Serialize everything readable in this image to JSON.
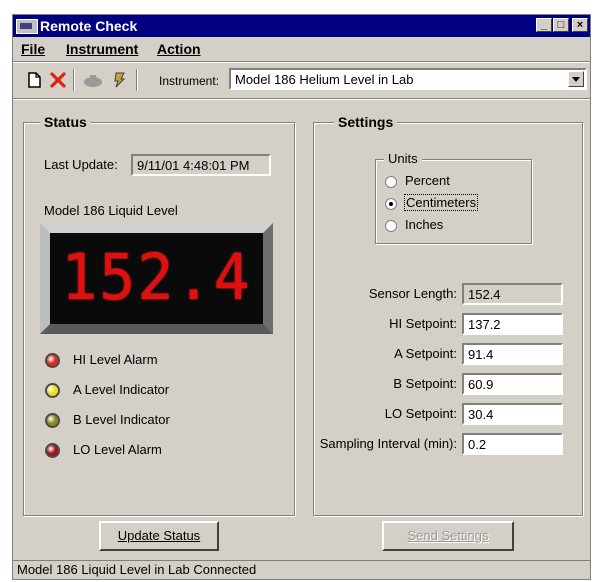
{
  "window": {
    "title": "Remote Check",
    "min_glyph": "_",
    "max_glyph": "□",
    "close_glyph": "×"
  },
  "menu": {
    "file": "File",
    "instrument": "Instrument",
    "action": "Action"
  },
  "toolbar": {
    "icons": [
      "new-document-icon",
      "delete-icon",
      "disconnect-icon",
      "connect-icon"
    ],
    "instrument_label": "Instrument:",
    "instrument_value": "Model 186 Helium Level in Lab"
  },
  "status": {
    "title": "Status",
    "last_update_label": "Last Update:",
    "last_update_value": "9/11/01 4:48:01 PM",
    "level_label": "Model 186 Liquid Level",
    "level_value": "152.4",
    "display_color": "#e01010",
    "indicators": [
      {
        "label": "HI Level Alarm",
        "color": "#d83020"
      },
      {
        "label": "A Level Indicator",
        "color": "#e8e020"
      },
      {
        "label": "B Level Indicator",
        "color": "#8a8a20"
      },
      {
        "label": "LO Level Alarm",
        "color": "#a01818"
      }
    ],
    "update_button": "Update Status"
  },
  "settings": {
    "title": "Settings",
    "units_title": "Units",
    "units_options": [
      "Percent",
      "Centimeters",
      "Inches"
    ],
    "units_selected": "Centimeters",
    "fields": [
      {
        "label": "Sensor Length:",
        "value": "152.4",
        "readonly": true
      },
      {
        "label": "HI Setpoint:",
        "value": "137.2",
        "readonly": false
      },
      {
        "label": "A Setpoint:",
        "value": "91.4",
        "readonly": false
      },
      {
        "label": "B Setpoint:",
        "value": "60.9",
        "readonly": false
      },
      {
        "label": "LO Setpoint:",
        "value": "30.4",
        "readonly": false
      },
      {
        "label": "Sampling Interval (min):",
        "value": "0.2",
        "readonly": false
      }
    ],
    "send_button": "Send Settings"
  },
  "statusbar": {
    "text": "Model 186  Liquid Level in Lab Connected"
  }
}
